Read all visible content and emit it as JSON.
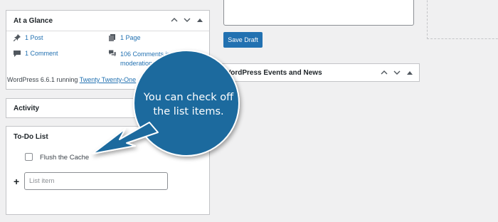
{
  "at_a_glance": {
    "title": "At a Glance",
    "posts": "1 Post",
    "pages": "1 Page",
    "comments": "1 Comment",
    "moderation_line1": "106 Comments in",
    "moderation_line2": "moderation",
    "running_text": "WordPress 6.6.1 running ",
    "theme": "Twenty Twenty-One"
  },
  "activity": {
    "title": "Activity"
  },
  "todo": {
    "title": "To-Do List",
    "items": [
      {
        "label": "Flush the Cache",
        "checked": false
      }
    ],
    "add_placeholder": "List item",
    "add_icon": "plus-icon"
  },
  "draft": {
    "save_label": "Save Draft"
  },
  "events": {
    "title": "WordPress Events and News"
  },
  "callout": {
    "text_line1": "You can check off",
    "text_line2": "the list items.",
    "color": "#1b6a9e"
  },
  "colors": {
    "accent": "#2271b1",
    "background": "#f0f0f1"
  }
}
